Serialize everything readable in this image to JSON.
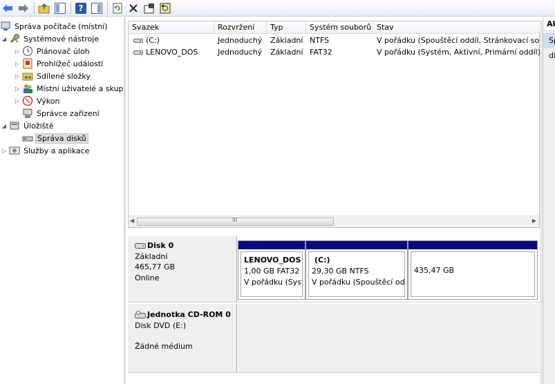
{
  "toolbar": {
    "icons": [
      "back-arrow-icon",
      "forward-arrow-icon",
      "up-folder-icon",
      "show-hide-tree-icon",
      "help-icon",
      "show-hide-action-icon",
      "refresh-icon",
      "delete-icon",
      "properties-icon",
      "disk-icon"
    ],
    "help_glyph": "?"
  },
  "tree": {
    "root": "Správa počítače (místní)",
    "system_tools": "Systémové nástroje",
    "task_scheduler": "Plánovač úloh",
    "event_viewer": "Prohlížeč událostí",
    "shared_folders": "Sdílené složky",
    "local_users": "Místní uživatelé a skupiny",
    "performance": "Výkon",
    "device_manager": "Správce zařízení",
    "storage": "Úložiště",
    "disk_management": "Správa disků",
    "services": "Služby a aplikace"
  },
  "volumes": {
    "columns": [
      "Svazek",
      "Rozvržení",
      "Typ",
      "Systém souborů",
      "Stav"
    ],
    "rows": [
      {
        "name": "(C:)",
        "layout": "Jednoduchý",
        "type": "Základní",
        "fs": "NTFS",
        "status": "V pořádku (Spouštěcí oddíl, Stránkovací soubor"
      },
      {
        "name": "LENOVO_DOS",
        "layout": "Jednoduchý",
        "type": "Základní",
        "fs": "FAT32",
        "status": "V pořádku (Systém, Aktivní, Primární oddíl)"
      }
    ],
    "scroll_grip": "III"
  },
  "actions": {
    "title": "Akce",
    "item": "Správa disků"
  },
  "disks": {
    "disk0": {
      "name": "Disk 0",
      "kind": "Základní",
      "size": "465,77 GB",
      "status": "Online",
      "partitions": [
        {
          "label": "LENOVO_DOS",
          "size": "1,00 GB FAT32",
          "status": "V pořádku (Systém, Aktivní, Primární oddíl)"
        },
        {
          "label": "(C:)",
          "size": "29,30 GB NTFS",
          "status": "V pořádku (Spouštěcí oddíl, Stránkovací soubor)"
        },
        {
          "label": "",
          "size": "435,47 GB",
          "status": ""
        }
      ]
    },
    "cdrom0": {
      "name": "Jednotka CD-ROM 0",
      "kind": "Disk DVD (E:)",
      "status": "Žádné médium"
    }
  }
}
